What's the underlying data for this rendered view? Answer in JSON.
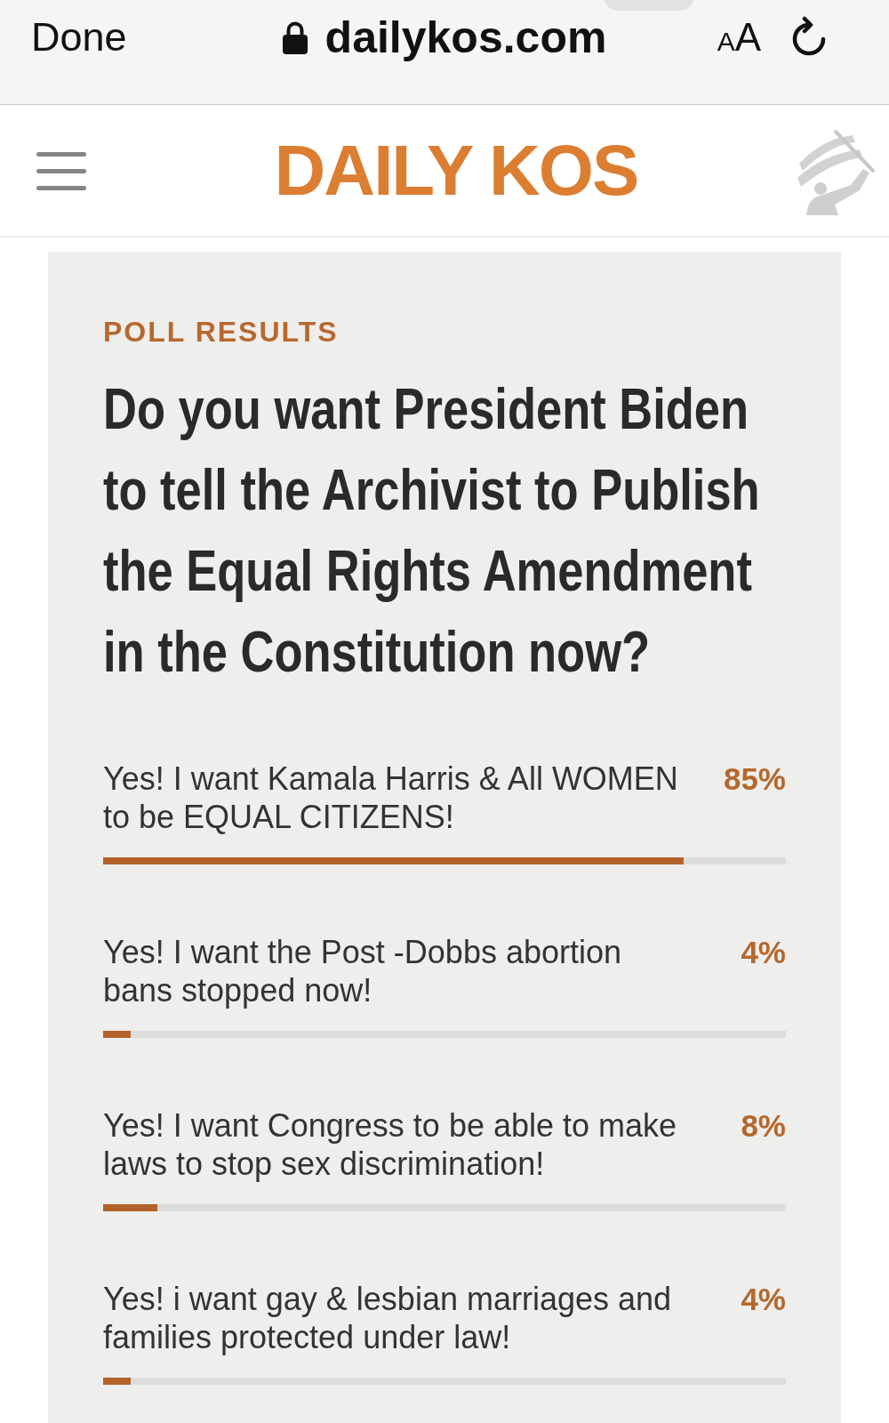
{
  "browser_bar": {
    "done_button": "Done",
    "address": "dailykos.com",
    "text_size_button": "AA"
  },
  "site_header": {
    "logo": "DAILY KOS"
  },
  "poll": {
    "heading": "POLL RESULTS",
    "question": "Do you want President Biden to tell the Archivist to Publish the Equal Rights Amendment in the Constitution now?",
    "options": [
      {
        "label": "Yes! I want Kamala Harris & All WOMEN to be EQUAL CITIZENS!",
        "percent": "85%",
        "level": 0.85
      },
      {
        "label": "Yes! I want the Post -Dobbs abortion bans stopped now!",
        "percent": "4%",
        "level": 0.04
      },
      {
        "label": "Yes! I want Congress to be able to make laws to stop sex discrimination!",
        "percent": "8%",
        "level": 0.08
      },
      {
        "label": "Yes! i want gay & lesbian marriages and families protected under law!",
        "percent": "4%",
        "level": 0.04
      }
    ]
  }
}
